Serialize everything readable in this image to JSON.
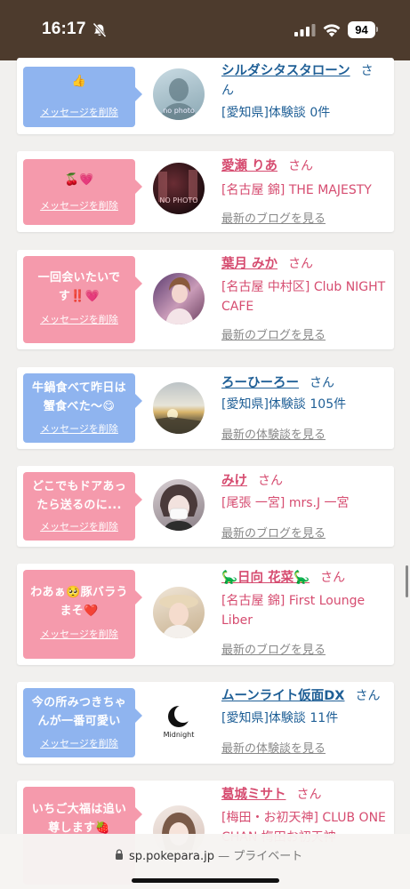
{
  "status": {
    "time": "16:17",
    "battery": "94"
  },
  "delete_label": "メッセージを削除",
  "san": "さん",
  "cards": [
    {
      "message": "👍",
      "name": "シルダシタスタローン",
      "info": "[愛知県]体験談 0件",
      "link": ""
    },
    {
      "message": "🍒💗",
      "name": "愛瀬 りあ",
      "info": "[名古屋 錦] THE MAJESTY",
      "link": "最新のブログを見る"
    },
    {
      "message": "一回会いたいです‼️💗",
      "name": "葉月 みか",
      "info": "[名古屋 中村区] Club NIGHT CAFE",
      "link": "最新のブログを見る"
    },
    {
      "message": "牛鍋食べて昨日は蟹食べた〜😋",
      "name": "ろーひーろー",
      "info": "[愛知県]体験談 105件",
      "link": "最新の体験談を見る"
    },
    {
      "message": "どこでもドアあったら送るのに...",
      "name": "みけ",
      "info": "[尾張 一宮] mrs.J 一宮",
      "link": "最新のブログを見る"
    },
    {
      "message": "わあぁ🥺豚バラうまそ❤️",
      "name": "🦕日向 花菜🦕",
      "info": "[名古屋 錦] First Lounge Liber",
      "link": "最新のブログを見る"
    },
    {
      "message": "今の所みつきちゃんが一番可愛い",
      "name": "ムーンライト仮面DX",
      "info": "[愛知県]体験談 11件",
      "link": "最新の体験談を見る"
    },
    {
      "message": "いちご大福は追い尊します🍓",
      "name": "葛城ミサト",
      "info": "[梅田・お初天神] CLUB ONE CHAN 梅田お初天神",
      "link": ""
    }
  ],
  "avatar_texts": [
    "no photo",
    "NO PHOTO",
    "Midnight"
  ],
  "url_bar": {
    "domain": "sp.pokepara.jp",
    "separator": "—",
    "mode": "プライベート"
  }
}
